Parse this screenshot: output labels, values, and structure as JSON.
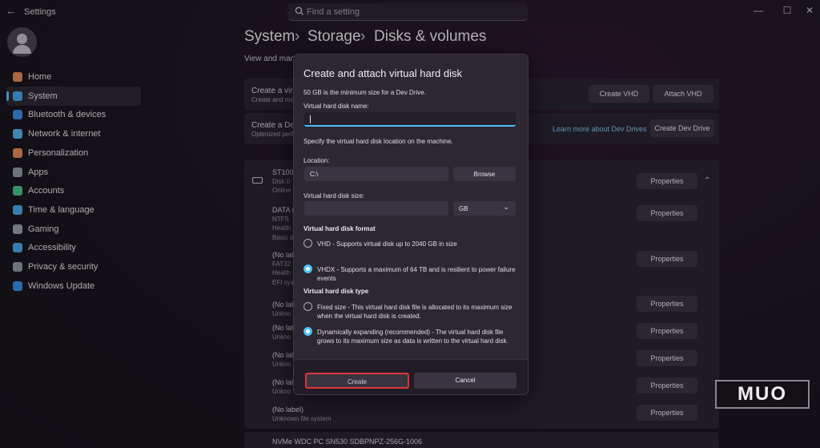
{
  "window": {
    "title": "Settings",
    "back_glyph": "←",
    "min_glyph": "—",
    "max_glyph": "☐",
    "close_glyph": "✕"
  },
  "search": {
    "placeholder": "Find a setting"
  },
  "sidebar": {
    "items": [
      {
        "label": "Home",
        "icon": "home-icon",
        "color": "#e08a5c"
      },
      {
        "label": "System",
        "icon": "system-icon",
        "color": "#4aa8e8"
      },
      {
        "label": "Bluetooth & devices",
        "icon": "bluetooth-icon",
        "color": "#3d8ee6"
      },
      {
        "label": "Network & internet",
        "icon": "network-icon",
        "color": "#5ab0f0"
      },
      {
        "label": "Personalization",
        "icon": "brush-icon",
        "color": "#e88a5a"
      },
      {
        "label": "Apps",
        "icon": "apps-icon",
        "color": "#8e9aa8"
      },
      {
        "label": "Accounts",
        "icon": "accounts-icon",
        "color": "#4cc08a"
      },
      {
        "label": "Time & language",
        "icon": "globe-clock-icon",
        "color": "#4aa8e8"
      },
      {
        "label": "Gaming",
        "icon": "gaming-icon",
        "color": "#9aa2ac"
      },
      {
        "label": "Accessibility",
        "icon": "accessibility-icon",
        "color": "#4aa8e8"
      },
      {
        "label": "Privacy & security",
        "icon": "shield-icon",
        "color": "#8e9aa8"
      },
      {
        "label": "Windows Update",
        "icon": "update-icon",
        "color": "#3d8ee6"
      }
    ]
  },
  "breadcrumb": {
    "a": "System",
    "b": "Storage",
    "c": "Disks & volumes",
    "sep": "›"
  },
  "subtitle": "View and manag",
  "vhd_card": {
    "title": "Create a virtu",
    "sub": "Create and mo",
    "create": "Create VHD",
    "attach": "Attach VHD"
  },
  "devdrive_card": {
    "title": "Create a Dev",
    "sub": "Optimized perf",
    "link": "Learn more about Dev Drives",
    "button": "Create Dev Drive"
  },
  "disk1": {
    "title": "ST1000",
    "sub1": "Disk 0",
    "sub2": "Online",
    "expand_glyph": "⌃"
  },
  "properties_label": "Properties",
  "volumes": [
    {
      "l1": "DATA (",
      "l2": "NTFS",
      "l3": "Health",
      "l4": "Basic d"
    },
    {
      "l1": "(No lab",
      "l2": "FAT32",
      "l3": "Health",
      "l4": "EFI sys"
    },
    {
      "l1": "(No lab",
      "l2": "Unkno"
    },
    {
      "l1": "(No lab",
      "l2": "Unkno"
    },
    {
      "l1": "(No lab",
      "l2": "Unkno"
    },
    {
      "l1": "(No lab",
      "l2": "Unkno"
    },
    {
      "l1": "(No label)",
      "l2": "Unknown file system"
    }
  ],
  "disk2": {
    "title": "NVMe WDC PC SN530 SDBPNPZ-256G-1006"
  },
  "dialog": {
    "title": "Create and attach virtual hard disk",
    "min_note": "50 GB is the minimum size for a Dev Drive.",
    "name_label": "Virtual hard disk name:",
    "name_value": "",
    "location_hint": "Specify the virtual hard disk location on the machine.",
    "location_label": "Location:",
    "location_value": "C:\\",
    "browse": "Browse",
    "size_label": "Virtual hard disk size:",
    "size_value": "",
    "unit": "GB",
    "unit_chevron": "⌄",
    "format_heading": "Virtual hard disk format",
    "format_vhd": "VHD - Supports virtual disk up to 2040 GB in size",
    "format_vhdx": "VHDX - Supports a maximum of 64 TB and is resilient to power failure events",
    "type_heading": "Virtual hard disk type",
    "type_fixed": "Fixed size - This virtual hard disk file is allocated to its maximum size when the virtual hard disk is created.",
    "type_dynamic": "Dynamically expanding (recommended) - The virtual hard disk file grows to its maximum size as data is written to the virtual hard disk.",
    "create": "Create",
    "cancel": "Cancel"
  },
  "watermark": "MUO",
  "colors": {
    "accent": "#4cc2ff",
    "highlight": "#e0353a"
  }
}
